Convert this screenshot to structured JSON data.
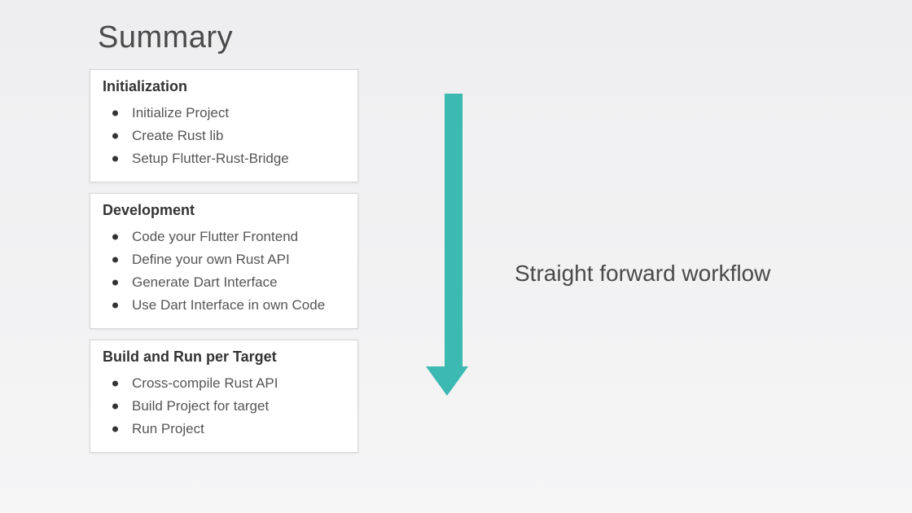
{
  "title": "Summary",
  "arrow_color": "#3cb9b1",
  "side_label": "Straight forward workflow",
  "cards": {
    "0": {
      "title": "Initialization",
      "items": {
        "0": "Initialize Project",
        "1": "Create Rust lib",
        "2": "Setup Flutter-Rust-Bridge"
      }
    },
    "1": {
      "title": "Development",
      "items": {
        "0": "Code your Flutter Frontend",
        "1": "Define your own Rust API",
        "2": "Generate Dart Interface",
        "3": "Use Dart Interface in own Code"
      }
    },
    "2": {
      "title": "Build and Run per Target",
      "items": {
        "0": "Cross-compile Rust API",
        "1": "Build Project for target",
        "2": "Run Project"
      }
    }
  }
}
